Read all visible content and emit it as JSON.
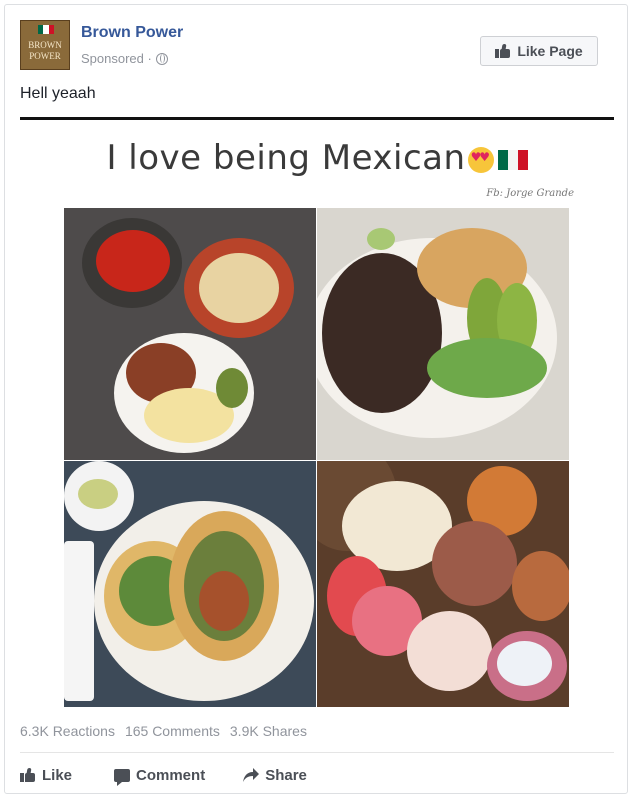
{
  "post": {
    "page_name": "Brown Power",
    "sponsored_label": "Sponsored ·",
    "like_page_label": "Like Page",
    "text": "Hell yeaah",
    "logo_lines": [
      "BROWN",
      "POWER"
    ]
  },
  "image": {
    "caption": "I love being Mexican",
    "credit": "Fb: Jorge Grande",
    "tiles": [
      "chips-salsa-beans-eggs",
      "carne-asada-plate",
      "tacos-plate",
      "pan-dulce"
    ]
  },
  "stats": {
    "reactions": "6.3K Reactions",
    "comments": "165 Comments",
    "shares": "3.9K Shares"
  },
  "actions": {
    "like": "Like",
    "comment": "Comment",
    "share": "Share"
  },
  "colors": {
    "brand_link": "#365899",
    "meta_gray": "#90949c",
    "action_gray": "#4b4f56",
    "flag_green": "#006847",
    "flag_white": "#ffffff",
    "flag_red": "#ce1126"
  },
  "icons": {
    "like_page": "thumbs-up-icon",
    "audience": "globe-icon",
    "like": "thumbs-up-icon",
    "comment": "comment-bubble-icon",
    "share": "share-arrow-icon",
    "emoji": "heart-eyes-emoji",
    "flag": "mexico-flag"
  }
}
